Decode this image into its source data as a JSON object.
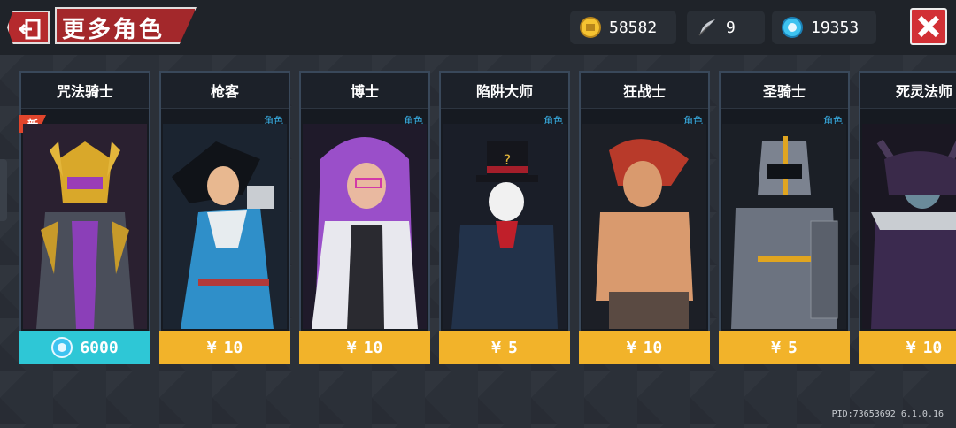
{
  "header": {
    "title": "更多角色"
  },
  "currencies": {
    "gold": {
      "icon": "gold-coin-icon",
      "value": "58582"
    },
    "feather": {
      "icon": "feather-icon",
      "value": "9"
    },
    "gem": {
      "icon": "blue-gem-icon",
      "value": "19353"
    }
  },
  "characters": [
    {
      "name": "咒法骑士",
      "type": "",
      "is_new": true,
      "new_label": "新",
      "price_currency": "gem",
      "price": "6000",
      "accent": "#8b3fb8"
    },
    {
      "name": "枪客",
      "type": "角色",
      "is_new": false,
      "price_currency": "yen",
      "price_symbol": "¥",
      "price": "10",
      "accent": "#2a8fc9"
    },
    {
      "name": "博士",
      "type": "角色",
      "is_new": false,
      "price_currency": "yen",
      "price_symbol": "¥",
      "price": "10",
      "accent": "#a052c8"
    },
    {
      "name": "陷阱大师",
      "type": "角色",
      "is_new": false,
      "price_currency": "yen",
      "price_symbol": "¥",
      "price": "5",
      "accent": "#8a1e26"
    },
    {
      "name": "狂战士",
      "type": "角色",
      "is_new": false,
      "price_currency": "yen",
      "price_symbol": "¥",
      "price": "10",
      "accent": "#c4472f"
    },
    {
      "name": "圣骑士",
      "type": "角色",
      "is_new": false,
      "price_currency": "yen",
      "price_symbol": "¥",
      "price": "5",
      "accent": "#e0a520"
    },
    {
      "name": "死灵法师",
      "type": "",
      "is_new": false,
      "price_currency": "yen",
      "price_symbol": "¥",
      "price": "10",
      "accent": "#5a3b7a"
    }
  ],
  "footer": {
    "pid": "PID:73653692 6.1.0.16"
  },
  "colors": {
    "price_yen_bg": "#f2b32a",
    "price_gem_bg": "#2ec7d6",
    "header_red": "#b52a2d",
    "type_label": "#3ab4ec"
  }
}
